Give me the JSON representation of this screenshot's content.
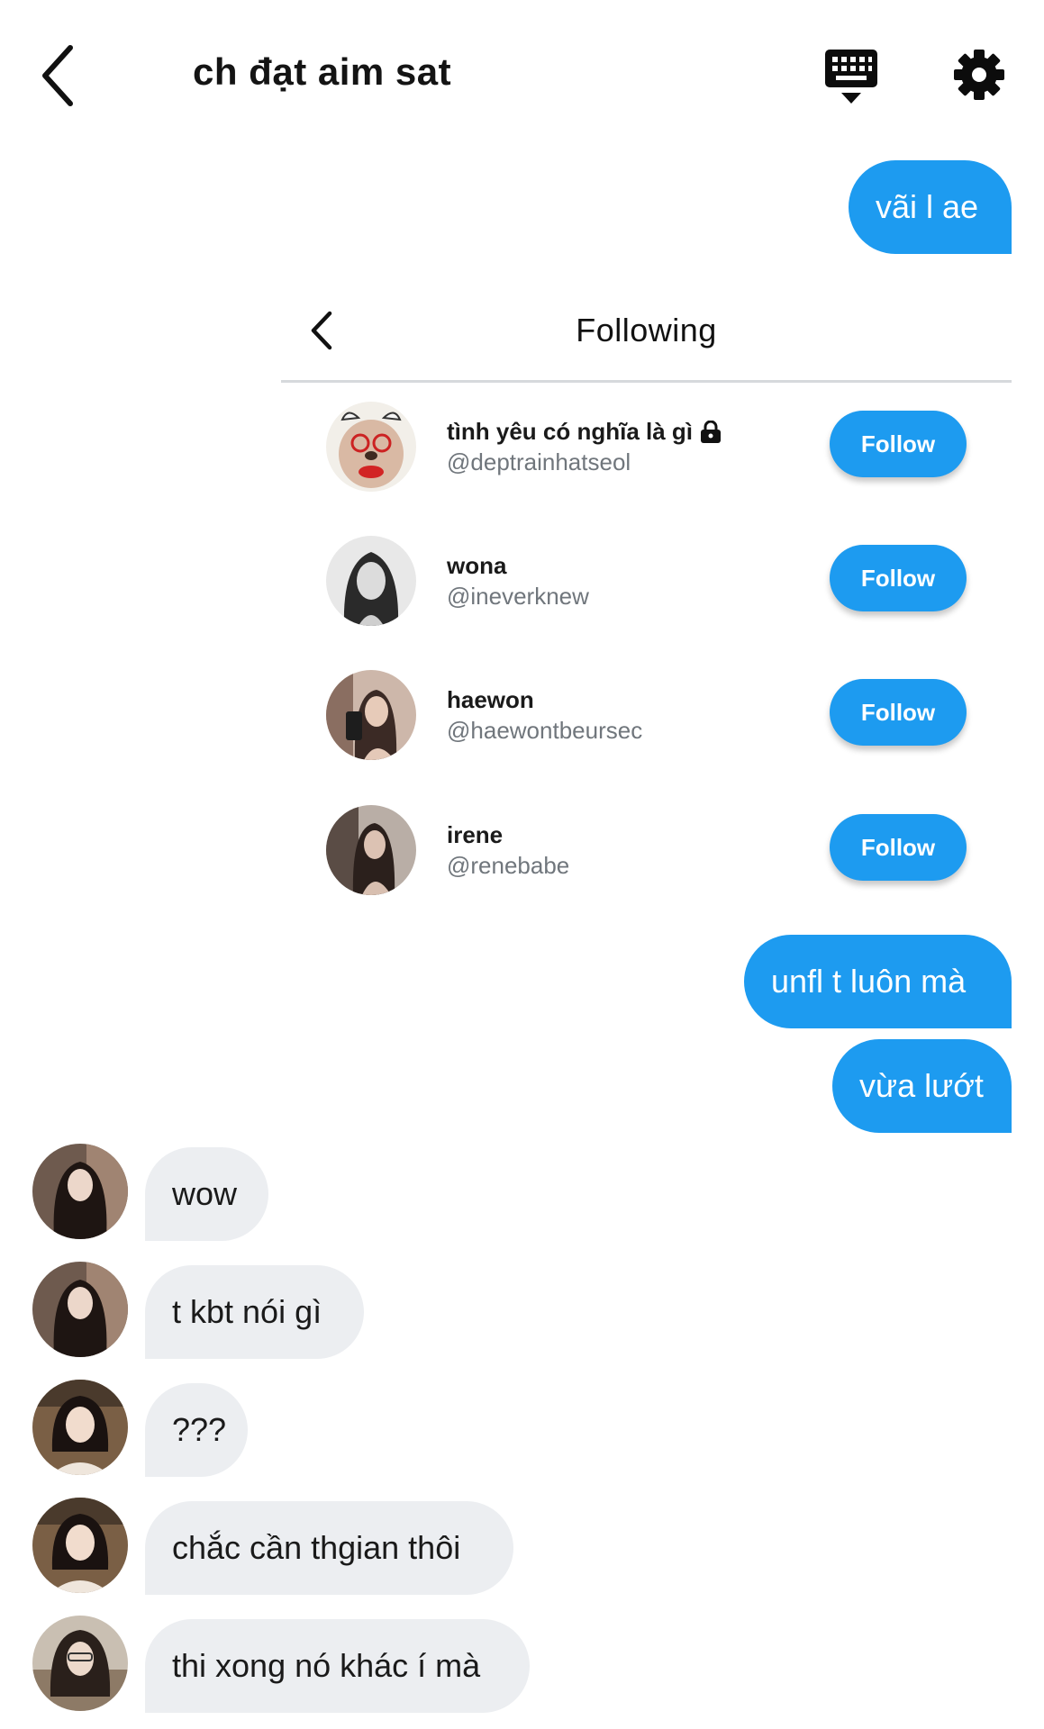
{
  "header": {
    "title": "ch đạt aim sat",
    "back_icon": "chevron-left-icon",
    "keyboard_icon": "keyboard-icon",
    "settings_icon": "gear-icon"
  },
  "messages_top": [
    {
      "text": "vãi l ae",
      "direction": "outgoing"
    }
  ],
  "shared_card": {
    "title": "Following",
    "back_icon": "chevron-left-icon",
    "follow_label": "Follow",
    "users": [
      {
        "name": "tình yêu có nghĩa là gì",
        "handle": "@deptrainhatseol",
        "locked": true
      },
      {
        "name": "wona",
        "handle": "@ineverknew",
        "locked": false
      },
      {
        "name": "haewon",
        "handle": "@haewontbeursec",
        "locked": false
      },
      {
        "name": "irene",
        "handle": "@renebabe",
        "locked": false
      }
    ]
  },
  "messages_mid": [
    {
      "text": "unfl t luôn mà",
      "direction": "outgoing"
    },
    {
      "text": "vừa lướt",
      "direction": "outgoing"
    }
  ],
  "messages_incoming": [
    {
      "text": "wow"
    },
    {
      "text": "t kbt nói gì"
    },
    {
      "text": "???"
    },
    {
      "text": "chắc cần thgian thôi"
    },
    {
      "text": "thi xong nó khác í mà"
    }
  ],
  "colors": {
    "accent": "#1d9bf0",
    "incoming_bubble": "#eceef1",
    "handle_gray": "#70767c",
    "divider": "#d6d9dc"
  }
}
